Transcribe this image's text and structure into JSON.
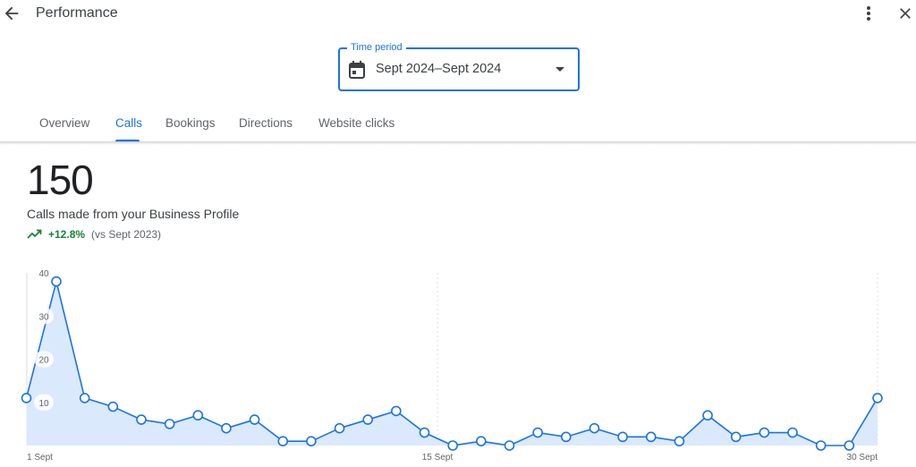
{
  "header": {
    "title": "Performance",
    "back_icon": "arrow-back-icon",
    "more_icon": "more-vert-icon",
    "close_icon": "close-icon"
  },
  "time_period": {
    "label": "Time period",
    "value": "Sept 2024–Sept 2024",
    "icon": "calendar-icon"
  },
  "tabs": [
    {
      "label": "Overview",
      "active": false
    },
    {
      "label": "Calls",
      "active": true
    },
    {
      "label": "Bookings",
      "active": false
    },
    {
      "label": "Directions",
      "active": false
    },
    {
      "label": "Website clicks",
      "active": false
    }
  ],
  "metric": {
    "value": "150",
    "label": "Calls made from your Business Profile",
    "trend": "+12.8%",
    "comparison": "(vs Sept 2023)"
  },
  "colors": {
    "accent": "#1a73e8",
    "positive": "#188038",
    "area_fill": "#dbe9fc"
  },
  "chart_data": {
    "type": "area",
    "x": [
      1,
      2,
      3,
      4,
      5,
      6,
      7,
      8,
      9,
      10,
      11,
      12,
      13,
      14,
      15,
      16,
      17,
      18,
      19,
      20,
      21,
      22,
      23,
      24,
      25,
      26,
      27,
      28,
      29,
      30
    ],
    "values": [
      38,
      11,
      9,
      6,
      5,
      7,
      4,
      6,
      1,
      1,
      4,
      6,
      8,
      3,
      0,
      1,
      0,
      3,
      2,
      4,
      2,
      2,
      1,
      7,
      2,
      3,
      3,
      0,
      0,
      11
    ],
    "first_value": 11,
    "yticks": [
      "10",
      "20",
      "30",
      "40"
    ],
    "ylim": [
      0,
      40
    ],
    "xtick_labels": [
      "1 Sept",
      "15 Sept",
      "30 Sept"
    ],
    "grid": "vertical dashed at 1 Sept, 15 Sept, 30 Sept"
  }
}
